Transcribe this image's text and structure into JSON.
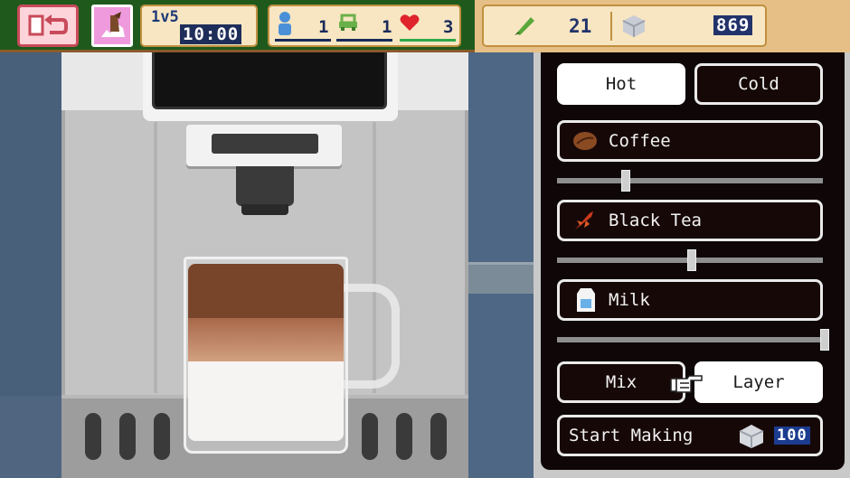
{
  "hud": {
    "day_label": "1v5",
    "time": "10:00",
    "customers": "1",
    "cars": "1",
    "hearts": "3",
    "leaves": "21",
    "sugar": "869"
  },
  "panel": {
    "hot_label": "Hot",
    "cold_label": "Cold",
    "temperature_selected": "Hot",
    "ingredients": [
      {
        "label": "Coffee",
        "amount": 0.25
      },
      {
        "label": "Black Tea",
        "amount": 0.5
      },
      {
        "label": "Milk",
        "amount": 1.0
      }
    ],
    "mix_label": "Mix",
    "layer_label": "Layer",
    "method_selected": "Layer",
    "start_label": "Start Making",
    "cost": "100"
  },
  "colors": {
    "hud_green": "#1f5a1c",
    "hud_tan": "#e6bf86",
    "coffee_layer": "#79452a",
    "tea_layer": "#b87a58",
    "milk_layer": "#f6f4f2",
    "heart_red": "#e0242c",
    "cost_badge": "#1b3c8f"
  },
  "icons": [
    "return-icon",
    "event-icon",
    "customer-icon",
    "car-icon",
    "heart-icon",
    "leaf-icon",
    "sugar-icon",
    "coffee-bean-icon",
    "tea-leaf-icon",
    "milk-carton-icon",
    "pointing-hand-icon"
  ]
}
